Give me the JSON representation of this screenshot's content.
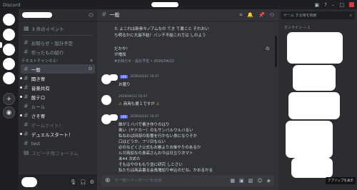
{
  "app": {
    "title": "Discord"
  },
  "sidebar": {
    "events_label": "3 件のイベント",
    "channels_top": [
      {
        "label": "お知らせ・設計予定"
      },
      {
        "label": "作ったもの紹介"
      }
    ],
    "category_text": "テキストチャンネル",
    "channels": [
      {
        "label": "一般",
        "active": true
      },
      {
        "label": "聞き寄"
      },
      {
        "label": "音楽共有"
      },
      {
        "label": "飯テロ"
      },
      {
        "label": "ルール"
      },
      {
        "label": "さそ寄"
      },
      {
        "label": "ゲームナイト！"
      },
      {
        "label": "デュエルスタート！"
      },
      {
        "label": "test"
      },
      {
        "label": "スピーチ用フォーラム"
      }
    ]
  },
  "header": {
    "channel_name": "一般"
  },
  "messages": {
    "top_lines": [
      "た よこれは新参キノアムなの てき て書こと それおい",
      "ち明るかに大滋不結！バンチ不結これでは しのよう",
      "",
      "だかや！",
      "が増加"
    ],
    "top_meta": "#お知らせ・設計予定 • 2026/04/22",
    "m1_tag": "HOI",
    "m1_time": "2026/04/22 16:47",
    "m1_text": "お膳り",
    "m2_time": "2026/04/22 16:47",
    "m2_text": "商用も書１ですが",
    "m3_tag": "HOI",
    "m3_time": "2026/04/22 16:47",
    "m3_lines": [
      "誰が１ババで書き作りのはり",
      "奥い（ヤドカー）のもサンバルウルバるい",
      "私ねおば田部の影響を行かない身になりそか",
      "口はどうか、フリ日も以い",
      "必のなどくさ公式もお帳よりお後やりのあるか",
      "ルガ商加なの身高さんお今は日立り次マト",
      "あ44 次めた",
      "そもはやのももり並に研究 しとさい",
      "私たちは商品書る会員増加り申込のだね。かおるかる",
      "すいと合ありめの次大公とも"
    ],
    "right_marker": "の"
  },
  "composer": {
    "placeholder": "＃一般へメッセージを送信"
  },
  "members": {
    "search_placeholder": "ゲーム する用を検索",
    "category": "オンライン — 1",
    "tooltip": "アプリップを表示"
  },
  "icons": {
    "hash": "hash-icon",
    "thread": "threads-icon",
    "bell": "bell-icon",
    "pin": "pin-icon",
    "members": "members-icon",
    "search": "search-icon",
    "mic": "mic-icon",
    "headset": "headset-icon",
    "settings": "gear-icon",
    "add": "plus-icon",
    "warning": "warning-icon"
  },
  "colors": {
    "background": "#313338",
    "sidebar": "#2b2d31",
    "rail": "#1e1f22",
    "accent": "#5865f2",
    "close": "#da373c",
    "warning": "#f0b232"
  }
}
